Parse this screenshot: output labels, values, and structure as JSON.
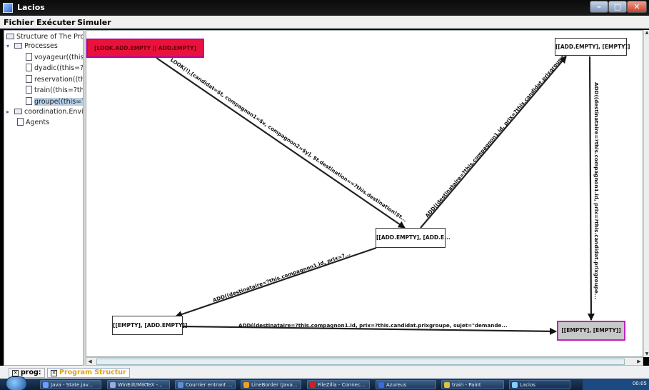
{
  "window": {
    "title": "Lacios"
  },
  "menu": [
    "Fichier",
    "Exécuter",
    "Simuler"
  ],
  "tree": {
    "root": "Structure of The Progra",
    "items": [
      {
        "label": "Processes",
        "type": "folder",
        "level": 1
      },
      {
        "label": "voyageur((this=",
        "type": "file",
        "level": 2
      },
      {
        "label": "dyadic((this=?t",
        "type": "file",
        "level": 2
      },
      {
        "label": "reservation((th",
        "type": "file",
        "level": 2
      },
      {
        "label": "train((this=?thi",
        "type": "file",
        "level": 2
      },
      {
        "label": "groupe((this=?",
        "type": "file",
        "level": 2,
        "selected": true
      },
      {
        "label": "coordination.Envir",
        "type": "folder",
        "level": 1
      },
      {
        "label": "Agents",
        "type": "file",
        "level": 1
      }
    ]
  },
  "graph": {
    "nodes": {
      "look": "[LOOK.ADD.EMPTY || ADD.EMPTY]",
      "add_empty_top": "[[ADD.EMPTY], [EMPTY]]",
      "add_mid": "[[ADD.EMPTY], [ADD.E...",
      "empty_add": "[[EMPTY], [ADD.EMPTY]]",
      "empty_empty": "[[EMPTY], [EMPTY]]"
    },
    "edges": {
      "look_to_mid": "LOOK(!),[candidat=$t, compagnon1=$x, compagnon2=$y], $t.destination==?this.destination!$t...",
      "mid_to_top": "ADD((destinataire=?this.compagnon1.id, prix=?this.candidat.prixgroupe...",
      "top_to_empty": "ADD((destinataire=?this.compagnon1.id, prix=?this.candidat.prixgroupe...",
      "mid_to_empty_add": "ADD((destinataire=?this.compagnon1.id, prix=?...",
      "empty_add_to_empty": "ADD((destinataire=?this.compagnon1.id, prix=?this.candidat.prixgroupe, sujet=\"demande..."
    }
  },
  "tabs": [
    {
      "label": "prog:"
    },
    {
      "label": "Program Structur"
    }
  ],
  "taskbar": {
    "items": [
      "Java - State.jav...",
      "WinEdt/MiKTeX -...",
      "Courrier entrant ...",
      "LineBorder (Java...",
      "FileZilla - Connec...",
      "Azureus",
      "train - Paint",
      "Lacios"
    ],
    "clock": "00:05"
  }
}
